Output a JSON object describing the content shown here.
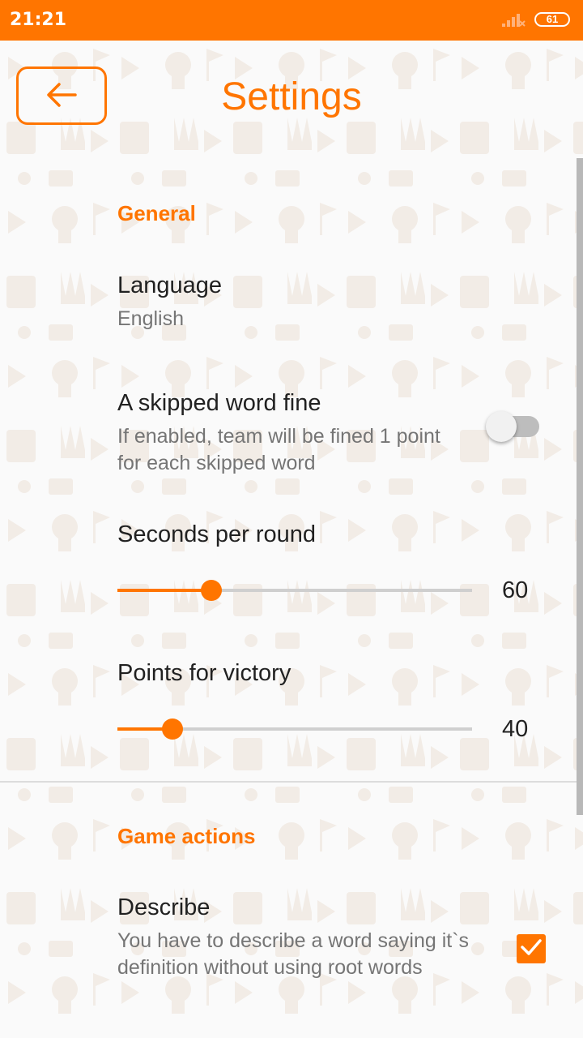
{
  "status_bar": {
    "time": "21:21",
    "battery": "61",
    "color": "#ff7500"
  },
  "header": {
    "title": "Settings",
    "back_icon": "arrow-left-icon"
  },
  "general": {
    "section_title": "General",
    "language": {
      "title": "Language",
      "value": "English"
    },
    "skip_fine": {
      "title": "A skipped word fine",
      "summary": "If enabled, team will be fined 1 point for each skipped word",
      "enabled": false
    },
    "seconds": {
      "title": "Seconds per round",
      "value": "60",
      "fraction": 0.265
    },
    "points": {
      "title": "Points for victory",
      "value": "40",
      "fraction": 0.155
    }
  },
  "game_actions": {
    "section_title": "Game actions",
    "describe": {
      "title": "Describe",
      "summary": "You have to describe a word saying it`s definition without using root words",
      "checked": true
    }
  },
  "colors": {
    "accent": "#ff7500"
  }
}
